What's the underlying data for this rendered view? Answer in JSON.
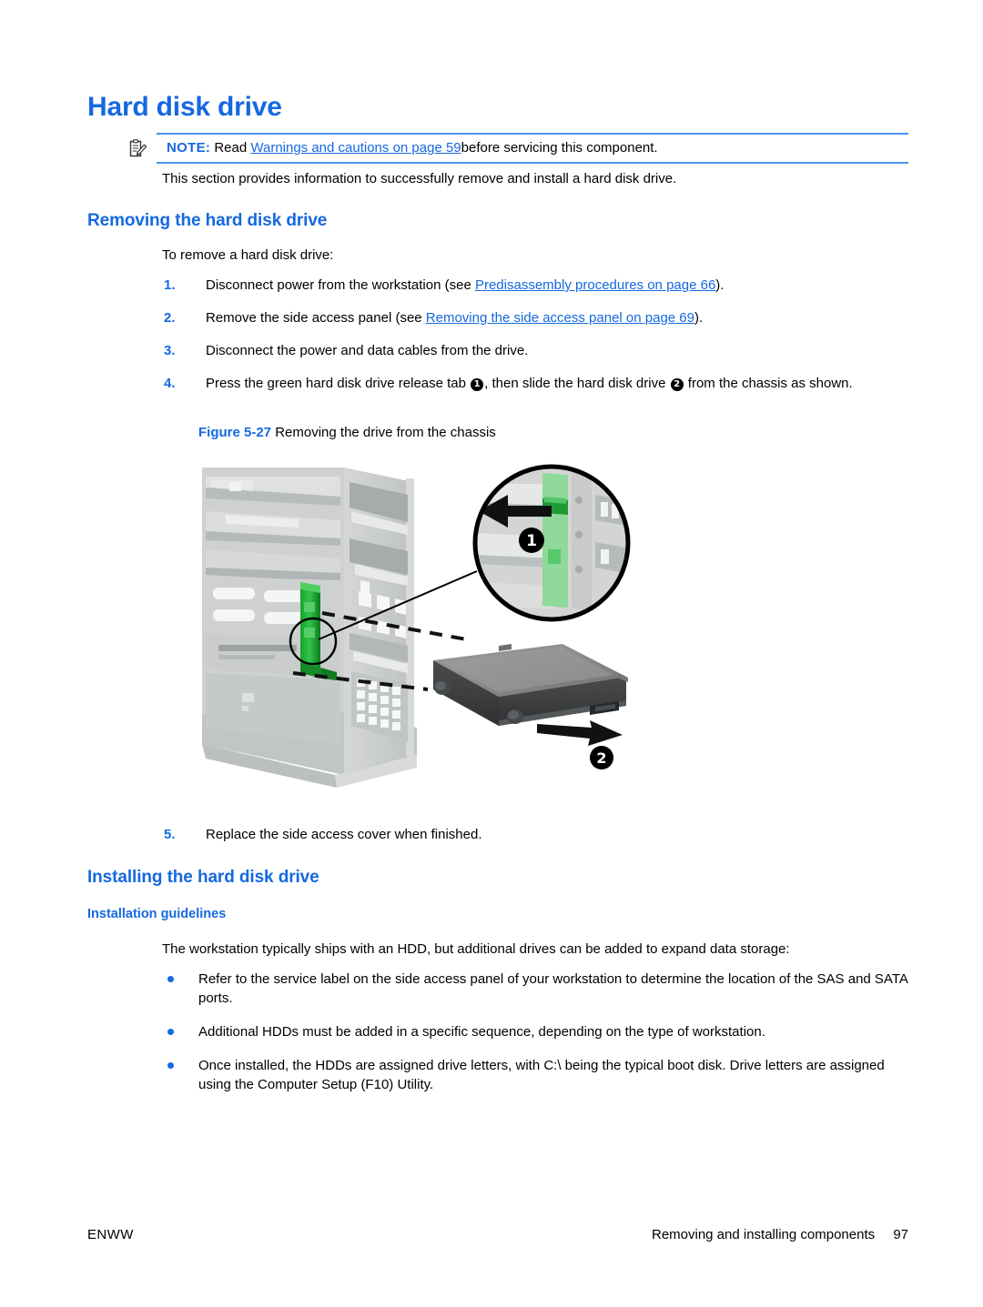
{
  "document": {
    "title": "Hard disk drive"
  },
  "note": {
    "icon": "note-clipboard-icon",
    "label": "NOTE:",
    "lead": "Read",
    "link_text": "Warnings and cautions on page 59",
    "tail": "before servicing this component.",
    "rule_color": "#4b93f2"
  },
  "intro": {
    "text": "This section provides information to successfully remove and install a hard disk drive."
  },
  "removing": {
    "heading": "Removing the hard disk drive",
    "lead_in": "To remove a hard disk drive:",
    "steps": [
      {
        "number": "1.",
        "prefix": "Disconnect power from the workstation (see ",
        "link_text": "Predisassembly procedures on page 66",
        "suffix": ")."
      },
      {
        "number": "2.",
        "prefix": "Remove the side access panel (see ",
        "link_text": "Removing the side access panel on page 69",
        "suffix": ")."
      },
      {
        "number": "3.",
        "prefix": "Disconnect the power and data cables from the drive.",
        "link_text": "",
        "suffix": ""
      }
    ],
    "step4": {
      "number": "4.",
      "part1": "Press the green hard disk drive release tab ",
      "callout1": "1",
      "part2": ", then slide the hard disk drive ",
      "callout2": "2",
      "part3": " from the chassis as shown."
    },
    "step5": {
      "number": "5.",
      "text": "Replace the side access cover when finished."
    }
  },
  "figure": {
    "number": "Figure 5-27",
    "caption": "Removing the drive from the chassis",
    "callouts": [
      "1",
      "2"
    ],
    "colors": {
      "release_tab_green": "#2aa83c",
      "chassis_gray": "#c9cbcb",
      "drive_dark": "#3b3d3f",
      "drive_top": "#8b8d8f"
    }
  },
  "installing": {
    "heading": "Installing the hard disk drive",
    "subheading": "Installation guidelines",
    "lead_in": "The workstation typically ships with an HDD, but additional drives can be added to expand data storage:",
    "bullets": [
      "Refer to the service label on the side access panel of your workstation to determine the location of the SAS and SATA ports.",
      "Additional HDDs must be added in a specific sequence, depending on the type of workstation.",
      "Once installed, the HDDs are assigned drive letters, with C:\\ being the typical boot disk. Drive letters are assigned using the Computer Setup (F10) Utility."
    ]
  },
  "footer": {
    "left": "ENWW",
    "right": "Removing and installing components",
    "page_number": "97"
  },
  "theme": {
    "accent_blue": "#1569e0",
    "rule_blue": "#4b93f2"
  }
}
